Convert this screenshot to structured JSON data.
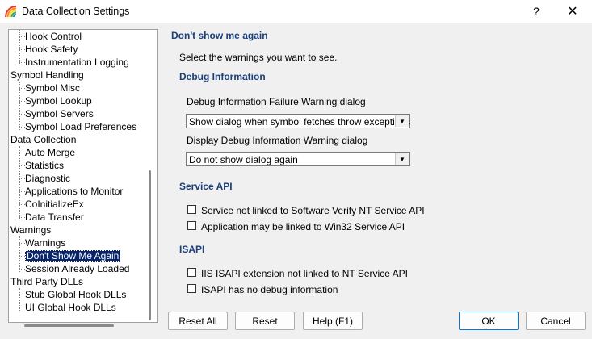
{
  "window": {
    "title": "Data Collection Settings",
    "help_glyph": "?",
    "close_glyph": "✕"
  },
  "tree": {
    "items": [
      {
        "label": "Hook Control",
        "level": 1
      },
      {
        "label": "Hook Safety",
        "level": 1
      },
      {
        "label": "Instrumentation Logging",
        "level": 1
      },
      {
        "label": "Symbol Handling",
        "level": 0
      },
      {
        "label": "Symbol Misc",
        "level": 1
      },
      {
        "label": "Symbol Lookup",
        "level": 1
      },
      {
        "label": "Symbol Servers",
        "level": 1
      },
      {
        "label": "Symbol Load Preferences",
        "level": 1
      },
      {
        "label": "Data Collection",
        "level": 0
      },
      {
        "label": "Auto Merge",
        "level": 1
      },
      {
        "label": "Statistics",
        "level": 1
      },
      {
        "label": "Diagnostic",
        "level": 1
      },
      {
        "label": "Applications to Monitor",
        "level": 1
      },
      {
        "label": "CoInitializeEx",
        "level": 1
      },
      {
        "label": "Data Transfer",
        "level": 1
      },
      {
        "label": "Warnings",
        "level": 0
      },
      {
        "label": "Warnings",
        "level": 1
      },
      {
        "label": "Don't Show Me Again",
        "level": 1,
        "selected": true
      },
      {
        "label": "Session Already Loaded",
        "level": 1
      },
      {
        "label": "Third Party DLLs",
        "level": 0
      },
      {
        "label": "Stub Global Hook DLLs",
        "level": 1
      },
      {
        "label": "UI Global Hook DLLs",
        "level": 1
      }
    ]
  },
  "panel": {
    "title": "Don't show me again",
    "intro": "Select the warnings you want to see.",
    "debug": {
      "heading": "Debug Information",
      "failure_label": "Debug Information Failure Warning dialog",
      "failure_value": "Show dialog when symbol fetches throw exceptions",
      "display_label": "Display Debug Information Warning dialog",
      "display_value": "Do not show dialog again"
    },
    "service": {
      "heading": "Service API",
      "options": [
        {
          "label": "Service not linked to Software Verify NT Service API",
          "checked": false
        },
        {
          "label": "Application may be linked to Win32 Service API",
          "checked": false
        }
      ]
    },
    "isapi": {
      "heading": "ISAPI",
      "options": [
        {
          "label": "IIS ISAPI extension not linked to NT Service API",
          "checked": false
        },
        {
          "label": "ISAPI has no debug information",
          "checked": false
        }
      ]
    }
  },
  "buttons": {
    "reset_all": "Reset All",
    "reset": "Reset",
    "help": "Help (F1)",
    "ok": "OK",
    "cancel": "Cancel"
  }
}
